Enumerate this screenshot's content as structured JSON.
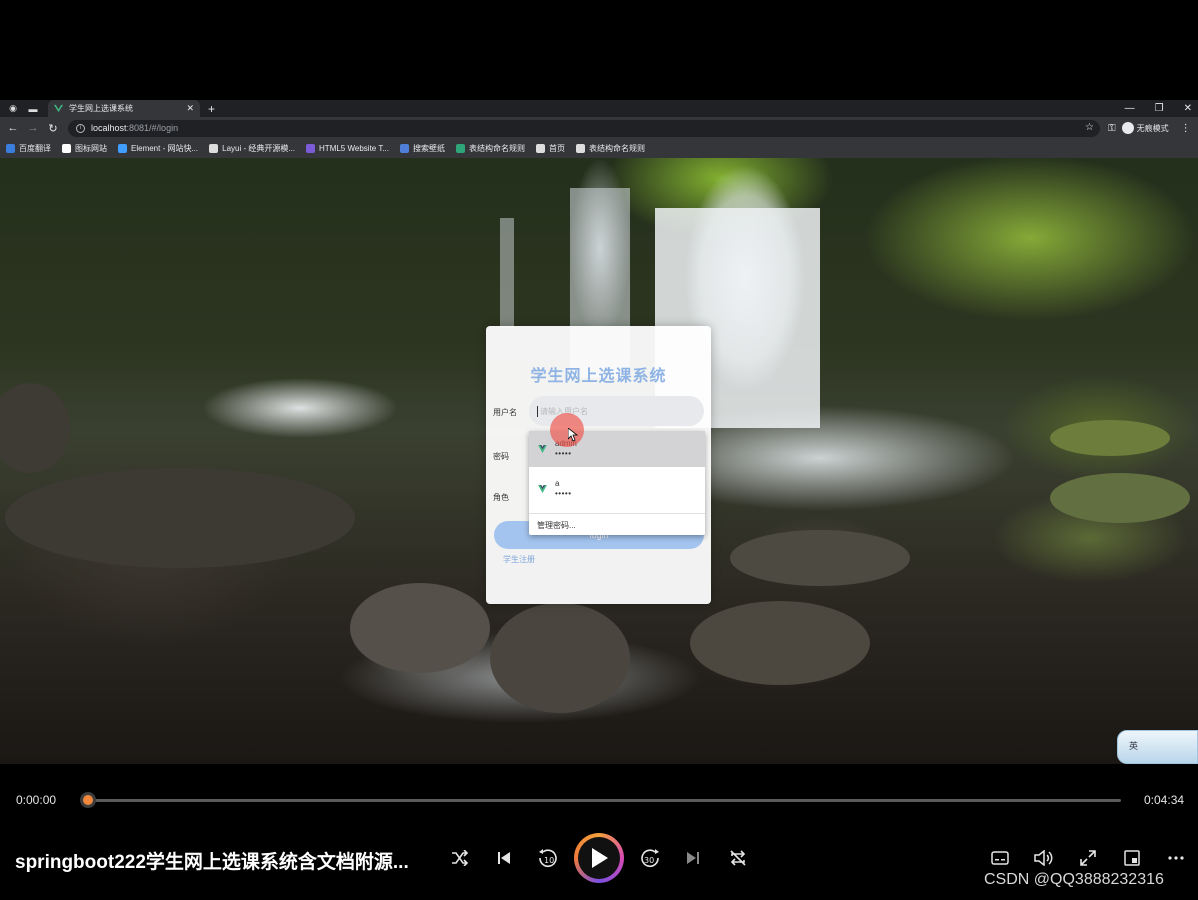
{
  "browser": {
    "tab_title": "学生网上选课系统",
    "url_host": "localhost",
    "url_path": ":8081/#/login",
    "profile_label": "无痕模式",
    "bookmarks": [
      {
        "label": "百度翻译",
        "color": "#3b7ddd"
      },
      {
        "label": "图标网站",
        "color": "#ffffff"
      },
      {
        "label": "Element - 网站快...",
        "color": "#409eff"
      },
      {
        "label": "Layui - 经典开源模...",
        "color": "#dddddd"
      },
      {
        "label": "HTML5 Website T...",
        "color": "#7c5cd6"
      },
      {
        "label": "搜索壁纸",
        "color": "#4f7fd9"
      },
      {
        "label": "表结构命名规则",
        "color": "#2fa57a"
      },
      {
        "label": "首页",
        "color": "#dddddd"
      },
      {
        "label": "表结构命名规则",
        "color": "#dddddd"
      }
    ]
  },
  "login": {
    "title": "学生网上选课系统",
    "username_label": "用户名",
    "username_placeholder": "请输入用户名",
    "password_label": "密码",
    "role_label": "角色",
    "login_button": "login",
    "register_link": "学生注册"
  },
  "autofill": {
    "entries": [
      {
        "username": "admin",
        "password": "•••••"
      },
      {
        "username": "a",
        "password": "•••••"
      }
    ],
    "manage_label": "管理密码..."
  },
  "ime": {
    "label": "英"
  },
  "player": {
    "current_time": "0:00:00",
    "total_time": "0:04:34",
    "progress": 0.0,
    "video_title": "springboot222学生网上选课系统含文档附源...",
    "watermark": "CSDN @QQ3888232316",
    "accent_color": "#f08a3a"
  }
}
